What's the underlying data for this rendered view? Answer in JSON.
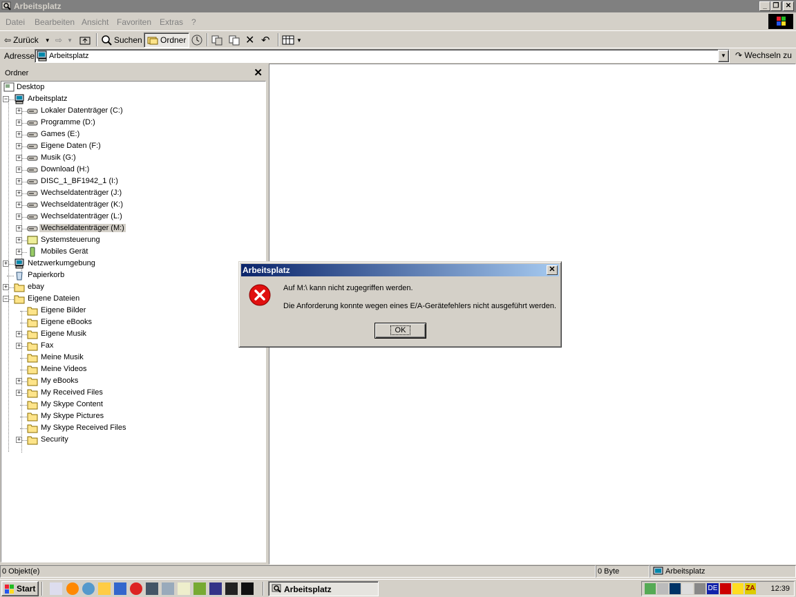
{
  "window": {
    "title": "Arbeitsplatz"
  },
  "menu": [
    "Datei",
    "Bearbeiten",
    "Ansicht",
    "Favoriten",
    "Extras",
    "?"
  ],
  "toolbar": {
    "back": "Zurück",
    "search": "Suchen",
    "folders": "Ordner"
  },
  "address": {
    "label": "Adresse",
    "value": "Arbeitsplatz",
    "go": "Wechseln zu"
  },
  "folder_pane": {
    "header": "Ordner"
  },
  "tree": [
    {
      "label": "Desktop",
      "icon": "desktop-icon"
    },
    {
      "label": "Arbeitsplatz",
      "icon": "computer-icon",
      "expanded": true
    },
    {
      "label": "Lokaler Datenträger (C:)",
      "icon": "drive-icon"
    },
    {
      "label": "Programme (D:)",
      "icon": "drive-icon"
    },
    {
      "label": "Games (E:)",
      "icon": "drive-icon"
    },
    {
      "label": "Eigene Daten (F:)",
      "icon": "drive-icon"
    },
    {
      "label": "Musik (G:)",
      "icon": "drive-icon"
    },
    {
      "label": "Download (H:)",
      "icon": "drive-icon"
    },
    {
      "label": "DISC_1_BF1942_1 (I:)",
      "icon": "cd-drive-icon"
    },
    {
      "label": "Wechseldatenträger (J:)",
      "icon": "removable-drive-icon"
    },
    {
      "label": "Wechseldatenträger (K:)",
      "icon": "removable-drive-icon"
    },
    {
      "label": "Wechseldatenträger (L:)",
      "icon": "removable-drive-icon"
    },
    {
      "label": "Wechseldatenträger (M:)",
      "icon": "removable-drive-icon",
      "selected": true
    },
    {
      "label": "Systemsteuerung",
      "icon": "control-panel-icon"
    },
    {
      "label": "Mobiles Gerät",
      "icon": "mobile-device-icon"
    },
    {
      "label": "Netzwerkumgebung",
      "icon": "network-icon"
    },
    {
      "label": "Papierkorb",
      "icon": "recycle-bin-icon"
    },
    {
      "label": "ebay",
      "icon": "folder-icon"
    },
    {
      "label": "Eigene Dateien",
      "icon": "my-documents-icon",
      "expanded": true
    },
    {
      "label": "Eigene Bilder",
      "icon": "pictures-folder-icon"
    },
    {
      "label": "Eigene eBooks",
      "icon": "folder-icon"
    },
    {
      "label": "Eigene Musik",
      "icon": "folder-icon"
    },
    {
      "label": "Fax",
      "icon": "folder-icon"
    },
    {
      "label": "Meine Musik",
      "icon": "folder-icon"
    },
    {
      "label": "Meine Videos",
      "icon": "folder-icon"
    },
    {
      "label": "My eBooks",
      "icon": "folder-icon"
    },
    {
      "label": "My Received Files",
      "icon": "folder-icon"
    },
    {
      "label": "My Skype Content",
      "icon": "folder-icon"
    },
    {
      "label": "My Skype Pictures",
      "icon": "folder-icon"
    },
    {
      "label": "My Skype Received Files",
      "icon": "folder-icon"
    },
    {
      "label": "Security",
      "icon": "folder-icon"
    }
  ],
  "status": {
    "objects": "0 Objekt(e)",
    "size": "0 Byte",
    "location": "Arbeitsplatz"
  },
  "taskbar": {
    "start": "Start",
    "task": "Arbeitsplatz",
    "clock": "12:39",
    "lang": "DE"
  },
  "dialog": {
    "title": "Arbeitsplatz",
    "line1": "Auf M:\\ kann nicht zugegriffen werden.",
    "line2": "Die Anforderung konnte wegen eines E/A-Gerätefehlers nicht ausgeführt werden.",
    "ok": "OK"
  }
}
